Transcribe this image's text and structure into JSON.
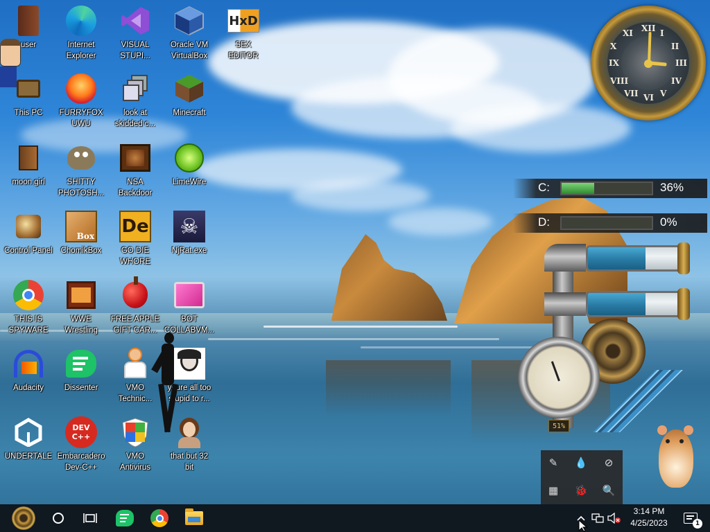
{
  "desktop": {
    "icons": [
      {
        "label": "user"
      },
      {
        "label": "Internet\nExplorer"
      },
      {
        "label": "VISUAL\nSTUPI..."
      },
      {
        "label": "Oracle VM\nVirtualBox"
      },
      {
        "label": "SEX\nEDITOR"
      },
      {
        "label": "This PC"
      },
      {
        "label": "FURRYFOX\nUWU"
      },
      {
        "label": "look at\nskidded c..."
      },
      {
        "label": "Minecraft"
      },
      {
        "label": "moon girl"
      },
      {
        "label": "SHITTY\nPHOTOSH..."
      },
      {
        "label": "NSA\nBackdoor"
      },
      {
        "label": "LimeWire"
      },
      {
        "label": "Control Panel"
      },
      {
        "label": "ChomikBox"
      },
      {
        "label": "GO DIE\nWHORE"
      },
      {
        "label": "NjRat.exe"
      },
      {
        "label": "THIS IS\nSPYWARE"
      },
      {
        "label": "WWE\nWrestling"
      },
      {
        "label": "FREE APPLE\nGIFT CAR..."
      },
      {
        "label": "BOT\nCOLLABVM..."
      },
      {
        "label": "Audacity"
      },
      {
        "label": "Dissenter"
      },
      {
        "label": "VMO\nTechnic..."
      },
      {
        "label": "youre all too\nstupid to r..."
      },
      {
        "label": "UNDERTALE"
      },
      {
        "label": "Embarcadero\nDev-C++"
      },
      {
        "label": "VMO\nAntivirus"
      },
      {
        "label": "that but 32\nbit"
      }
    ],
    "icon_badges": {
      "hex": "HxD",
      "chomik": "Box",
      "gimp_de": "De",
      "devcpp": "DEV\nC++"
    }
  },
  "drives": [
    {
      "label": "C:",
      "percent": "36%",
      "fill": 0.36
    },
    {
      "label": "D:",
      "percent": "0%",
      "fill": 0.0
    }
  ],
  "pipes_gadget": {
    "gauge_readout": "51%",
    "tube_levels": [
      0.62,
      0.62
    ]
  },
  "clock_gadget": {
    "numerals": [
      "XII",
      "III",
      "VI",
      "IX",
      "I",
      "II",
      "IV",
      "V",
      "VII",
      "VIII",
      "X",
      "XI"
    ]
  },
  "taskbar": {
    "time": "3:14 PM",
    "date": "4/25/2023",
    "notification_count": "1"
  }
}
